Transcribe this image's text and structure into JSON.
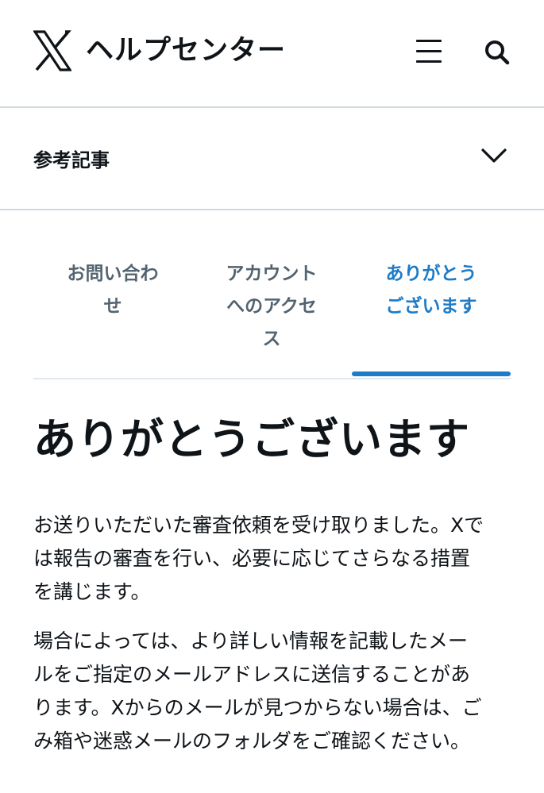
{
  "header": {
    "site_title": "ヘルプセンター",
    "logo_icon": "x-logo-icon",
    "menu_icon": "hamburger-menu-icon",
    "search_icon": "search-icon"
  },
  "related": {
    "label": "参考記事",
    "icon": "chevron-down-icon"
  },
  "tabs": [
    {
      "line1": "お問い合わ",
      "line2": "せ",
      "line3": "",
      "active": false
    },
    {
      "line1": "アカウント",
      "line2": "へのアクセ",
      "line3": "ス",
      "active": false
    },
    {
      "line1": "ありがとう",
      "line2": "ございます",
      "line3": "",
      "active": true
    }
  ],
  "main": {
    "title": "ありがとうございます",
    "para1": [
      "お送りいただいた審査依頼を受け取りました。Xで",
      "は報告の審査を行い、必要に応じてさらなる措置",
      "を講じます。"
    ],
    "para2": [
      "場合によっては、より詳しい情報を記載したメー",
      "ルをご指定のメールアドレスに送信することがあ",
      "ります。Xからのメールが見つからない場合は、ご",
      "み箱や迷惑メールのフォルダをご確認ください。"
    ]
  },
  "colors": {
    "accent": "#1d7bc7",
    "text": "#0f1419",
    "muted": "#536471",
    "divider": "#cfd9de"
  }
}
